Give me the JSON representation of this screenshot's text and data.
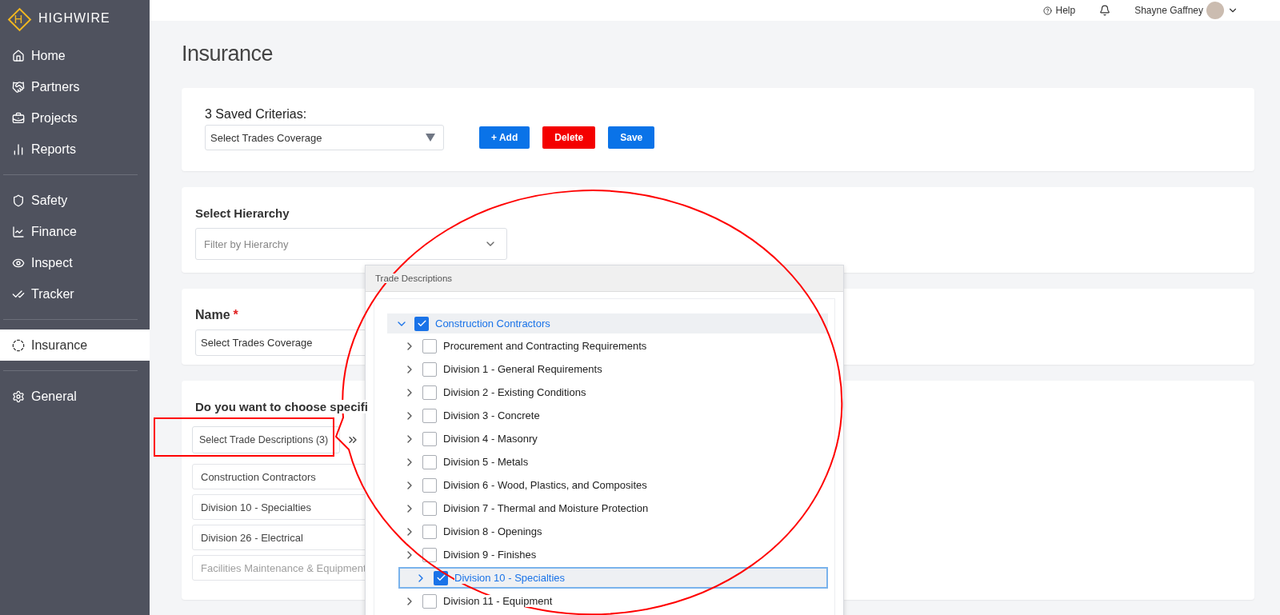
{
  "sidebar": {
    "logo": {
      "mark": "H",
      "name": "HIGHWIRE"
    },
    "groups": [
      [
        {
          "label": "Home",
          "selected": false
        },
        {
          "label": "Partners",
          "selected": false
        },
        {
          "label": "Projects",
          "selected": false
        },
        {
          "label": "Reports",
          "selected": false
        }
      ],
      [
        {
          "label": "Safety",
          "selected": false
        },
        {
          "label": "Finance",
          "selected": false
        },
        {
          "label": "Inspect",
          "selected": false
        },
        {
          "label": "Tracker",
          "selected": false
        }
      ],
      [
        {
          "label": "Insurance",
          "selected": true
        }
      ],
      [
        {
          "label": "General",
          "selected": false
        }
      ]
    ]
  },
  "top_bar": {
    "help": "Help",
    "user": "Shayne Gaffney"
  },
  "page_title": "Insurance",
  "saved_criteria": {
    "label": "3 Saved Criterias:",
    "select_value": "Select Trades Coverage",
    "buttons": [
      {
        "label": "+ Add",
        "kind": "primary"
      },
      {
        "label": "Delete",
        "kind": "danger"
      },
      {
        "label": "Save",
        "kind": "primary"
      }
    ]
  },
  "hierarchy": {
    "label": "Select Hierarchy",
    "placeholder": "Filter by Hierarchy"
  },
  "name": {
    "label": "Name",
    "required_mark": "*",
    "value": "Select Trades Coverage"
  },
  "trade": {
    "question": "Do you want to choose specifi",
    "trigger": "Select Trade Descriptions (3)",
    "selected_items": [
      {
        "label": "Construction Contractors",
        "disabled": false
      },
      {
        "label": "Division 10 - Specialties",
        "disabled": false
      },
      {
        "label": "Division 26 - Electrical",
        "disabled": false
      },
      {
        "label": "Facilities Maintenance & Equipment",
        "disabled": true
      }
    ]
  },
  "popup": {
    "title": "Trade Descriptions",
    "tree": [
      {
        "label": "Construction Contractors",
        "checked": true,
        "expanded": true,
        "selected": false,
        "children": [
          {
            "label": "Procurement and Contracting Requirements",
            "checked": false,
            "expanded": false,
            "selected": false
          },
          {
            "label": "Division 1 - General Requirements",
            "checked": false,
            "expanded": false,
            "selected": false
          },
          {
            "label": "Division 2 - Existing Conditions",
            "checked": false,
            "expanded": false,
            "selected": false
          },
          {
            "label": "Division 3 - Concrete",
            "checked": false,
            "expanded": false,
            "selected": false
          },
          {
            "label": "Division 4 - Masonry",
            "checked": false,
            "expanded": false,
            "selected": false
          },
          {
            "label": "Division 5 - Metals",
            "checked": false,
            "expanded": false,
            "selected": false
          },
          {
            "label": "Division 6 - Wood, Plastics, and Composites",
            "checked": false,
            "expanded": false,
            "selected": false
          },
          {
            "label": "Division 7 - Thermal and Moisture Protection",
            "checked": false,
            "expanded": false,
            "selected": false
          },
          {
            "label": "Division 8 - Openings",
            "checked": false,
            "expanded": false,
            "selected": false
          },
          {
            "label": "Division 9 - Finishes",
            "checked": false,
            "expanded": false,
            "selected": false
          },
          {
            "label": "Division 10 - Specialties",
            "checked": true,
            "expanded": false,
            "selected": true
          },
          {
            "label": "Division 11 - Equipment",
            "checked": false,
            "expanded": false,
            "selected": false
          }
        ]
      }
    ]
  }
}
